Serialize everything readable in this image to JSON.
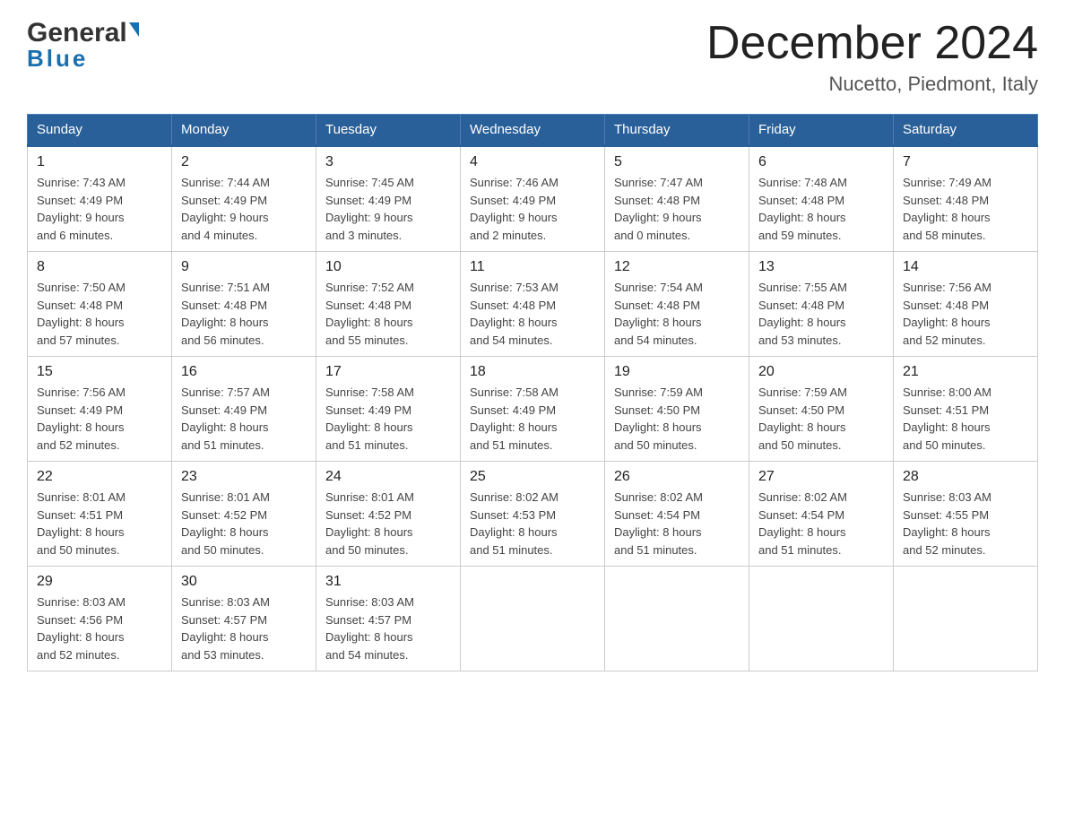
{
  "logo": {
    "name_part1": "General",
    "name_part2": "Blue"
  },
  "title": {
    "month_year": "December 2024",
    "location": "Nucetto, Piedmont, Italy"
  },
  "columns": [
    "Sunday",
    "Monday",
    "Tuesday",
    "Wednesday",
    "Thursday",
    "Friday",
    "Saturday"
  ],
  "weeks": [
    [
      {
        "day": "1",
        "sunrise": "Sunrise: 7:43 AM",
        "sunset": "Sunset: 4:49 PM",
        "daylight": "Daylight: 9 hours",
        "daylight2": "and 6 minutes."
      },
      {
        "day": "2",
        "sunrise": "Sunrise: 7:44 AM",
        "sunset": "Sunset: 4:49 PM",
        "daylight": "Daylight: 9 hours",
        "daylight2": "and 4 minutes."
      },
      {
        "day": "3",
        "sunrise": "Sunrise: 7:45 AM",
        "sunset": "Sunset: 4:49 PM",
        "daylight": "Daylight: 9 hours",
        "daylight2": "and 3 minutes."
      },
      {
        "day": "4",
        "sunrise": "Sunrise: 7:46 AM",
        "sunset": "Sunset: 4:49 PM",
        "daylight": "Daylight: 9 hours",
        "daylight2": "and 2 minutes."
      },
      {
        "day": "5",
        "sunrise": "Sunrise: 7:47 AM",
        "sunset": "Sunset: 4:48 PM",
        "daylight": "Daylight: 9 hours",
        "daylight2": "and 0 minutes."
      },
      {
        "day": "6",
        "sunrise": "Sunrise: 7:48 AM",
        "sunset": "Sunset: 4:48 PM",
        "daylight": "Daylight: 8 hours",
        "daylight2": "and 59 minutes."
      },
      {
        "day": "7",
        "sunrise": "Sunrise: 7:49 AM",
        "sunset": "Sunset: 4:48 PM",
        "daylight": "Daylight: 8 hours",
        "daylight2": "and 58 minutes."
      }
    ],
    [
      {
        "day": "8",
        "sunrise": "Sunrise: 7:50 AM",
        "sunset": "Sunset: 4:48 PM",
        "daylight": "Daylight: 8 hours",
        "daylight2": "and 57 minutes."
      },
      {
        "day": "9",
        "sunrise": "Sunrise: 7:51 AM",
        "sunset": "Sunset: 4:48 PM",
        "daylight": "Daylight: 8 hours",
        "daylight2": "and 56 minutes."
      },
      {
        "day": "10",
        "sunrise": "Sunrise: 7:52 AM",
        "sunset": "Sunset: 4:48 PM",
        "daylight": "Daylight: 8 hours",
        "daylight2": "and 55 minutes."
      },
      {
        "day": "11",
        "sunrise": "Sunrise: 7:53 AM",
        "sunset": "Sunset: 4:48 PM",
        "daylight": "Daylight: 8 hours",
        "daylight2": "and 54 minutes."
      },
      {
        "day": "12",
        "sunrise": "Sunrise: 7:54 AM",
        "sunset": "Sunset: 4:48 PM",
        "daylight": "Daylight: 8 hours",
        "daylight2": "and 54 minutes."
      },
      {
        "day": "13",
        "sunrise": "Sunrise: 7:55 AM",
        "sunset": "Sunset: 4:48 PM",
        "daylight": "Daylight: 8 hours",
        "daylight2": "and 53 minutes."
      },
      {
        "day": "14",
        "sunrise": "Sunrise: 7:56 AM",
        "sunset": "Sunset: 4:48 PM",
        "daylight": "Daylight: 8 hours",
        "daylight2": "and 52 minutes."
      }
    ],
    [
      {
        "day": "15",
        "sunrise": "Sunrise: 7:56 AM",
        "sunset": "Sunset: 4:49 PM",
        "daylight": "Daylight: 8 hours",
        "daylight2": "and 52 minutes."
      },
      {
        "day": "16",
        "sunrise": "Sunrise: 7:57 AM",
        "sunset": "Sunset: 4:49 PM",
        "daylight": "Daylight: 8 hours",
        "daylight2": "and 51 minutes."
      },
      {
        "day": "17",
        "sunrise": "Sunrise: 7:58 AM",
        "sunset": "Sunset: 4:49 PM",
        "daylight": "Daylight: 8 hours",
        "daylight2": "and 51 minutes."
      },
      {
        "day": "18",
        "sunrise": "Sunrise: 7:58 AM",
        "sunset": "Sunset: 4:49 PM",
        "daylight": "Daylight: 8 hours",
        "daylight2": "and 51 minutes."
      },
      {
        "day": "19",
        "sunrise": "Sunrise: 7:59 AM",
        "sunset": "Sunset: 4:50 PM",
        "daylight": "Daylight: 8 hours",
        "daylight2": "and 50 minutes."
      },
      {
        "day": "20",
        "sunrise": "Sunrise: 7:59 AM",
        "sunset": "Sunset: 4:50 PM",
        "daylight": "Daylight: 8 hours",
        "daylight2": "and 50 minutes."
      },
      {
        "day": "21",
        "sunrise": "Sunrise: 8:00 AM",
        "sunset": "Sunset: 4:51 PM",
        "daylight": "Daylight: 8 hours",
        "daylight2": "and 50 minutes."
      }
    ],
    [
      {
        "day": "22",
        "sunrise": "Sunrise: 8:01 AM",
        "sunset": "Sunset: 4:51 PM",
        "daylight": "Daylight: 8 hours",
        "daylight2": "and 50 minutes."
      },
      {
        "day": "23",
        "sunrise": "Sunrise: 8:01 AM",
        "sunset": "Sunset: 4:52 PM",
        "daylight": "Daylight: 8 hours",
        "daylight2": "and 50 minutes."
      },
      {
        "day": "24",
        "sunrise": "Sunrise: 8:01 AM",
        "sunset": "Sunset: 4:52 PM",
        "daylight": "Daylight: 8 hours",
        "daylight2": "and 50 minutes."
      },
      {
        "day": "25",
        "sunrise": "Sunrise: 8:02 AM",
        "sunset": "Sunset: 4:53 PM",
        "daylight": "Daylight: 8 hours",
        "daylight2": "and 51 minutes."
      },
      {
        "day": "26",
        "sunrise": "Sunrise: 8:02 AM",
        "sunset": "Sunset: 4:54 PM",
        "daylight": "Daylight: 8 hours",
        "daylight2": "and 51 minutes."
      },
      {
        "day": "27",
        "sunrise": "Sunrise: 8:02 AM",
        "sunset": "Sunset: 4:54 PM",
        "daylight": "Daylight: 8 hours",
        "daylight2": "and 51 minutes."
      },
      {
        "day": "28",
        "sunrise": "Sunrise: 8:03 AM",
        "sunset": "Sunset: 4:55 PM",
        "daylight": "Daylight: 8 hours",
        "daylight2": "and 52 minutes."
      }
    ],
    [
      {
        "day": "29",
        "sunrise": "Sunrise: 8:03 AM",
        "sunset": "Sunset: 4:56 PM",
        "daylight": "Daylight: 8 hours",
        "daylight2": "and 52 minutes."
      },
      {
        "day": "30",
        "sunrise": "Sunrise: 8:03 AM",
        "sunset": "Sunset: 4:57 PM",
        "daylight": "Daylight: 8 hours",
        "daylight2": "and 53 minutes."
      },
      {
        "day": "31",
        "sunrise": "Sunrise: 8:03 AM",
        "sunset": "Sunset: 4:57 PM",
        "daylight": "Daylight: 8 hours",
        "daylight2": "and 54 minutes."
      },
      null,
      null,
      null,
      null
    ]
  ]
}
